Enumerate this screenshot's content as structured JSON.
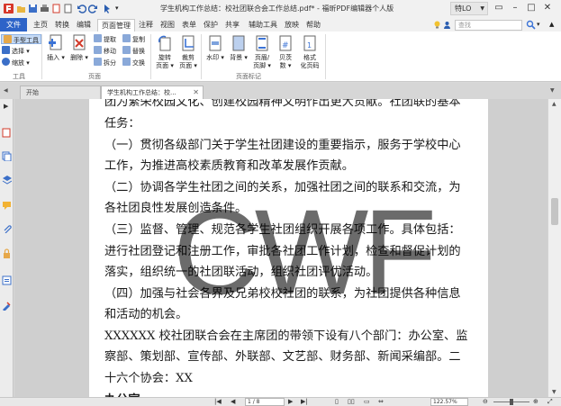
{
  "window": {
    "title": "学生机构工作总结：校社团联合会工作总结.pdf* - 福昕PDF编辑器个人版",
    "user_button": "特LO"
  },
  "ribbon_tabs": [
    {
      "label": "文件"
    },
    {
      "label": "主页"
    },
    {
      "label": "转换"
    },
    {
      "label": "编辑"
    },
    {
      "label": "页面管理"
    },
    {
      "label": "注释"
    },
    {
      "label": "视图"
    },
    {
      "label": "表单"
    },
    {
      "label": "保护"
    },
    {
      "label": "共享"
    },
    {
      "label": "辅助工具"
    },
    {
      "label": "放映"
    },
    {
      "label": "帮助"
    }
  ],
  "search": {
    "placeholder": "查找"
  },
  "ribbon": {
    "tools_group": {
      "hand": "手型工具",
      "select": "选择",
      "zoom": "缩放",
      "label": "工具"
    },
    "page_group": {
      "insert": "插入",
      "delete": "删除",
      "extract": "提取",
      "move": "移动",
      "split": "拆分",
      "copy": "复制",
      "replace": "替换",
      "swap": "交换",
      "label": "页面"
    },
    "rotate": {
      "line1": "旋转",
      "line2": "页面"
    },
    "crop": {
      "line1": "裁剪",
      "line2": "页面"
    },
    "watermark": "水印",
    "background": "背景",
    "header_footer": {
      "line1": "页眉/",
      "line2": "页脚"
    },
    "bates": {
      "line1": "贝茨",
      "line2": "数"
    },
    "format_page": {
      "line1": "格式",
      "line2": "化页码"
    },
    "page_marks_label": "页面标记"
  },
  "doc_tabs": [
    {
      "label": "开始"
    },
    {
      "label": "学生机构工作总结：校..."
    }
  ],
  "document": {
    "paragraphs": [
      "团为繁荣校园文化、创建校园精神文明作出更大贡献。社团联的基本",
      "任务：",
      "（一）贯彻各级部门关于学生社团建设的重要指示，服务于学校中心",
      "工作，为推进高校素质教育和改革发展作贡献。",
      "（二）协调各学生社团之间的关系，加强社团之间的联系和交流，为",
      "各社团良性发展创造条件。",
      "（三）监督、管理、规范各学生社团组织开展各项工作。具体包括：",
      "进行社团登记和注册工作，审批各社团工作计划，检查和督促计划的",
      "落实，组织统一的社团联活动，组织社团评优活动。",
      "（四）加强与社会各界及兄弟校校社团的联系，为社团提供各种信息",
      "和活动的机会。",
      "XXXXXX 校社团联合会在主席团的带领下设有八个部门：办公室、监",
      "察部、策划部、宣传部、外联部、文艺部、财务部、新闻采编部。二",
      "十六个协会：XX",
      "办公室"
    ],
    "watermark": "CWF"
  },
  "statusbar": {
    "page_indicator": "1 / 8",
    "zoom": "122.57%"
  },
  "colors": {
    "file_tab": "#2d63c8",
    "accent_blue": "#3b73d6",
    "accent_red": "#d23a2a",
    "ribbon_bg": "#ffffff"
  }
}
